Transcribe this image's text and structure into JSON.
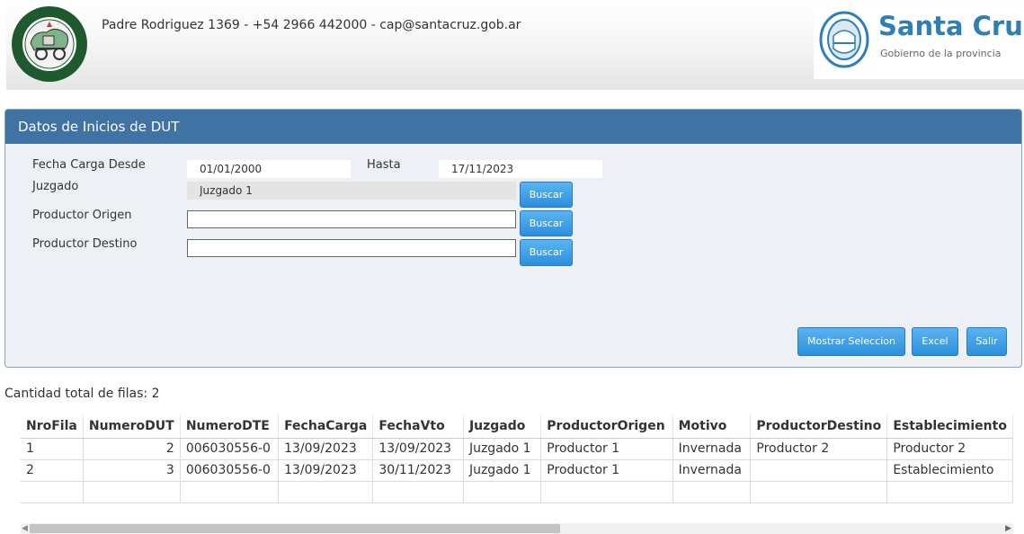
{
  "header": {
    "contact": "Padre Rodriguez 1369 - +54 2966 442000 - cap@santacruz.gob.ar",
    "brand_title": "Santa Cruz",
    "brand_subtitle": "Gobierno de la provincia"
  },
  "panel": {
    "title": "Datos de Inicios de DUT",
    "fecha_desde_label": "Fecha Carga Desde",
    "fecha_desde_value": "01/01/2000",
    "hasta_label": "Hasta",
    "hasta_value": "17/11/2023",
    "juzgado_label": "Juzgado",
    "juzgado_value": "Juzgado 1",
    "productor_origen_label": "Productor Origen",
    "productor_origen_value": "",
    "productor_destino_label": "Productor Destino",
    "productor_destino_value": "",
    "buscar_label": "Buscar",
    "mostrar_label": "Mostrar Seleccion",
    "excel_label": "Excel",
    "salir_label": "Salir"
  },
  "total_rows": "Cantidad total de filas: 2",
  "table": {
    "columns": [
      "NroFila",
      "NumeroDUT",
      "NumeroDTE",
      "FechaCarga",
      "FechaVto",
      "Juzgado",
      "ProductorOrigen",
      "Motivo",
      "ProductorDestino",
      "Establecimiento"
    ],
    "rows": [
      [
        "1",
        "2",
        "006030556-0",
        "13/09/2023",
        "13/09/2023",
        "Juzgado 1",
        "Productor 1",
        "Invernada",
        "Productor 2",
        "Productor 2"
      ],
      [
        "2",
        "3",
        "006030556-0",
        "13/09/2023",
        "30/11/2023",
        "Juzgado 1",
        "Productor 1",
        "Invernada",
        "",
        "Establecimiento"
      ]
    ]
  },
  "colors": {
    "panel_header": "#3f73a4",
    "button": "#3a9ce6",
    "brand": "#2f7fb5"
  },
  "icons": {
    "left_logo": "consejo-agrario-logo",
    "right_logo": "santa-cruz-shield-logo",
    "scroll_left": "arrow-left-icon",
    "scroll_right": "arrow-right-icon"
  }
}
